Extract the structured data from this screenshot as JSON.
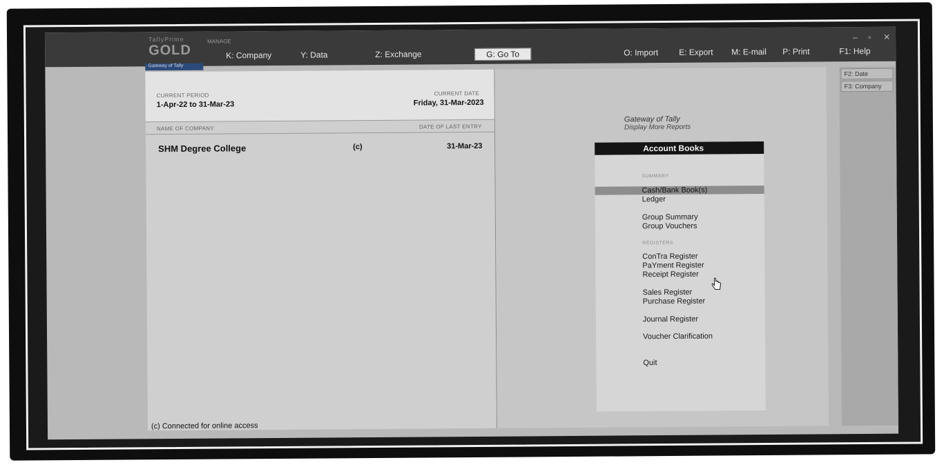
{
  "app": {
    "brand_small": "TallyPrime",
    "brand_edition": "GOLD",
    "manage_label": "MANAGE",
    "gateway_tab": "Gateway of Tally"
  },
  "menubar": {
    "company": "K: Company",
    "data": "Y: Data",
    "exchange": "Z: Exchange",
    "goto": "G: Go To",
    "import": "O: Import",
    "export": "E: Export",
    "email": "M: E-mail",
    "print": "P: Print",
    "help": "F1: Help"
  },
  "window_controls": {
    "minimize": "–",
    "maximize": "▫",
    "close": "✕"
  },
  "period": {
    "current_period_label": "CURRENT PERIOD",
    "current_period_value": "1-Apr-22 to 31-Mar-23",
    "current_date_label": "CURRENT DATE",
    "current_date_value": "Friday, 31-Mar-2023"
  },
  "companies": {
    "name_header": "NAME OF COMPANY",
    "last_entry_header": "DATE OF LAST ENTRY",
    "rows": [
      {
        "name": "SHM Degree College",
        "flag": "(c)",
        "last_entry": "31-Mar-23"
      }
    ]
  },
  "status": {
    "connection": "(c) Connected for online access"
  },
  "gateway": {
    "title": "Gateway of Tally",
    "subtitle": "Display More Reports"
  },
  "account_books": {
    "header": "Account Books",
    "section_summary": "SUMMARY",
    "section_registers": "REGISTERS",
    "items": {
      "cash_bank": "Cash/Bank Book(s)",
      "ledger": "Ledger",
      "group_summary": "Group Summary",
      "group_vouchers": "Group Vouchers",
      "contra": "ConTra Register",
      "payment": "PaYment Register",
      "receipt": "Receipt Register",
      "sales": "Sales Register",
      "purchase": "Purchase Register",
      "journal": "Journal Register",
      "voucher_clar": "Voucher Clarification",
      "quit": "Quit"
    }
  },
  "right_buttons": {
    "date": "F2: Date",
    "company": "F3: Company"
  }
}
